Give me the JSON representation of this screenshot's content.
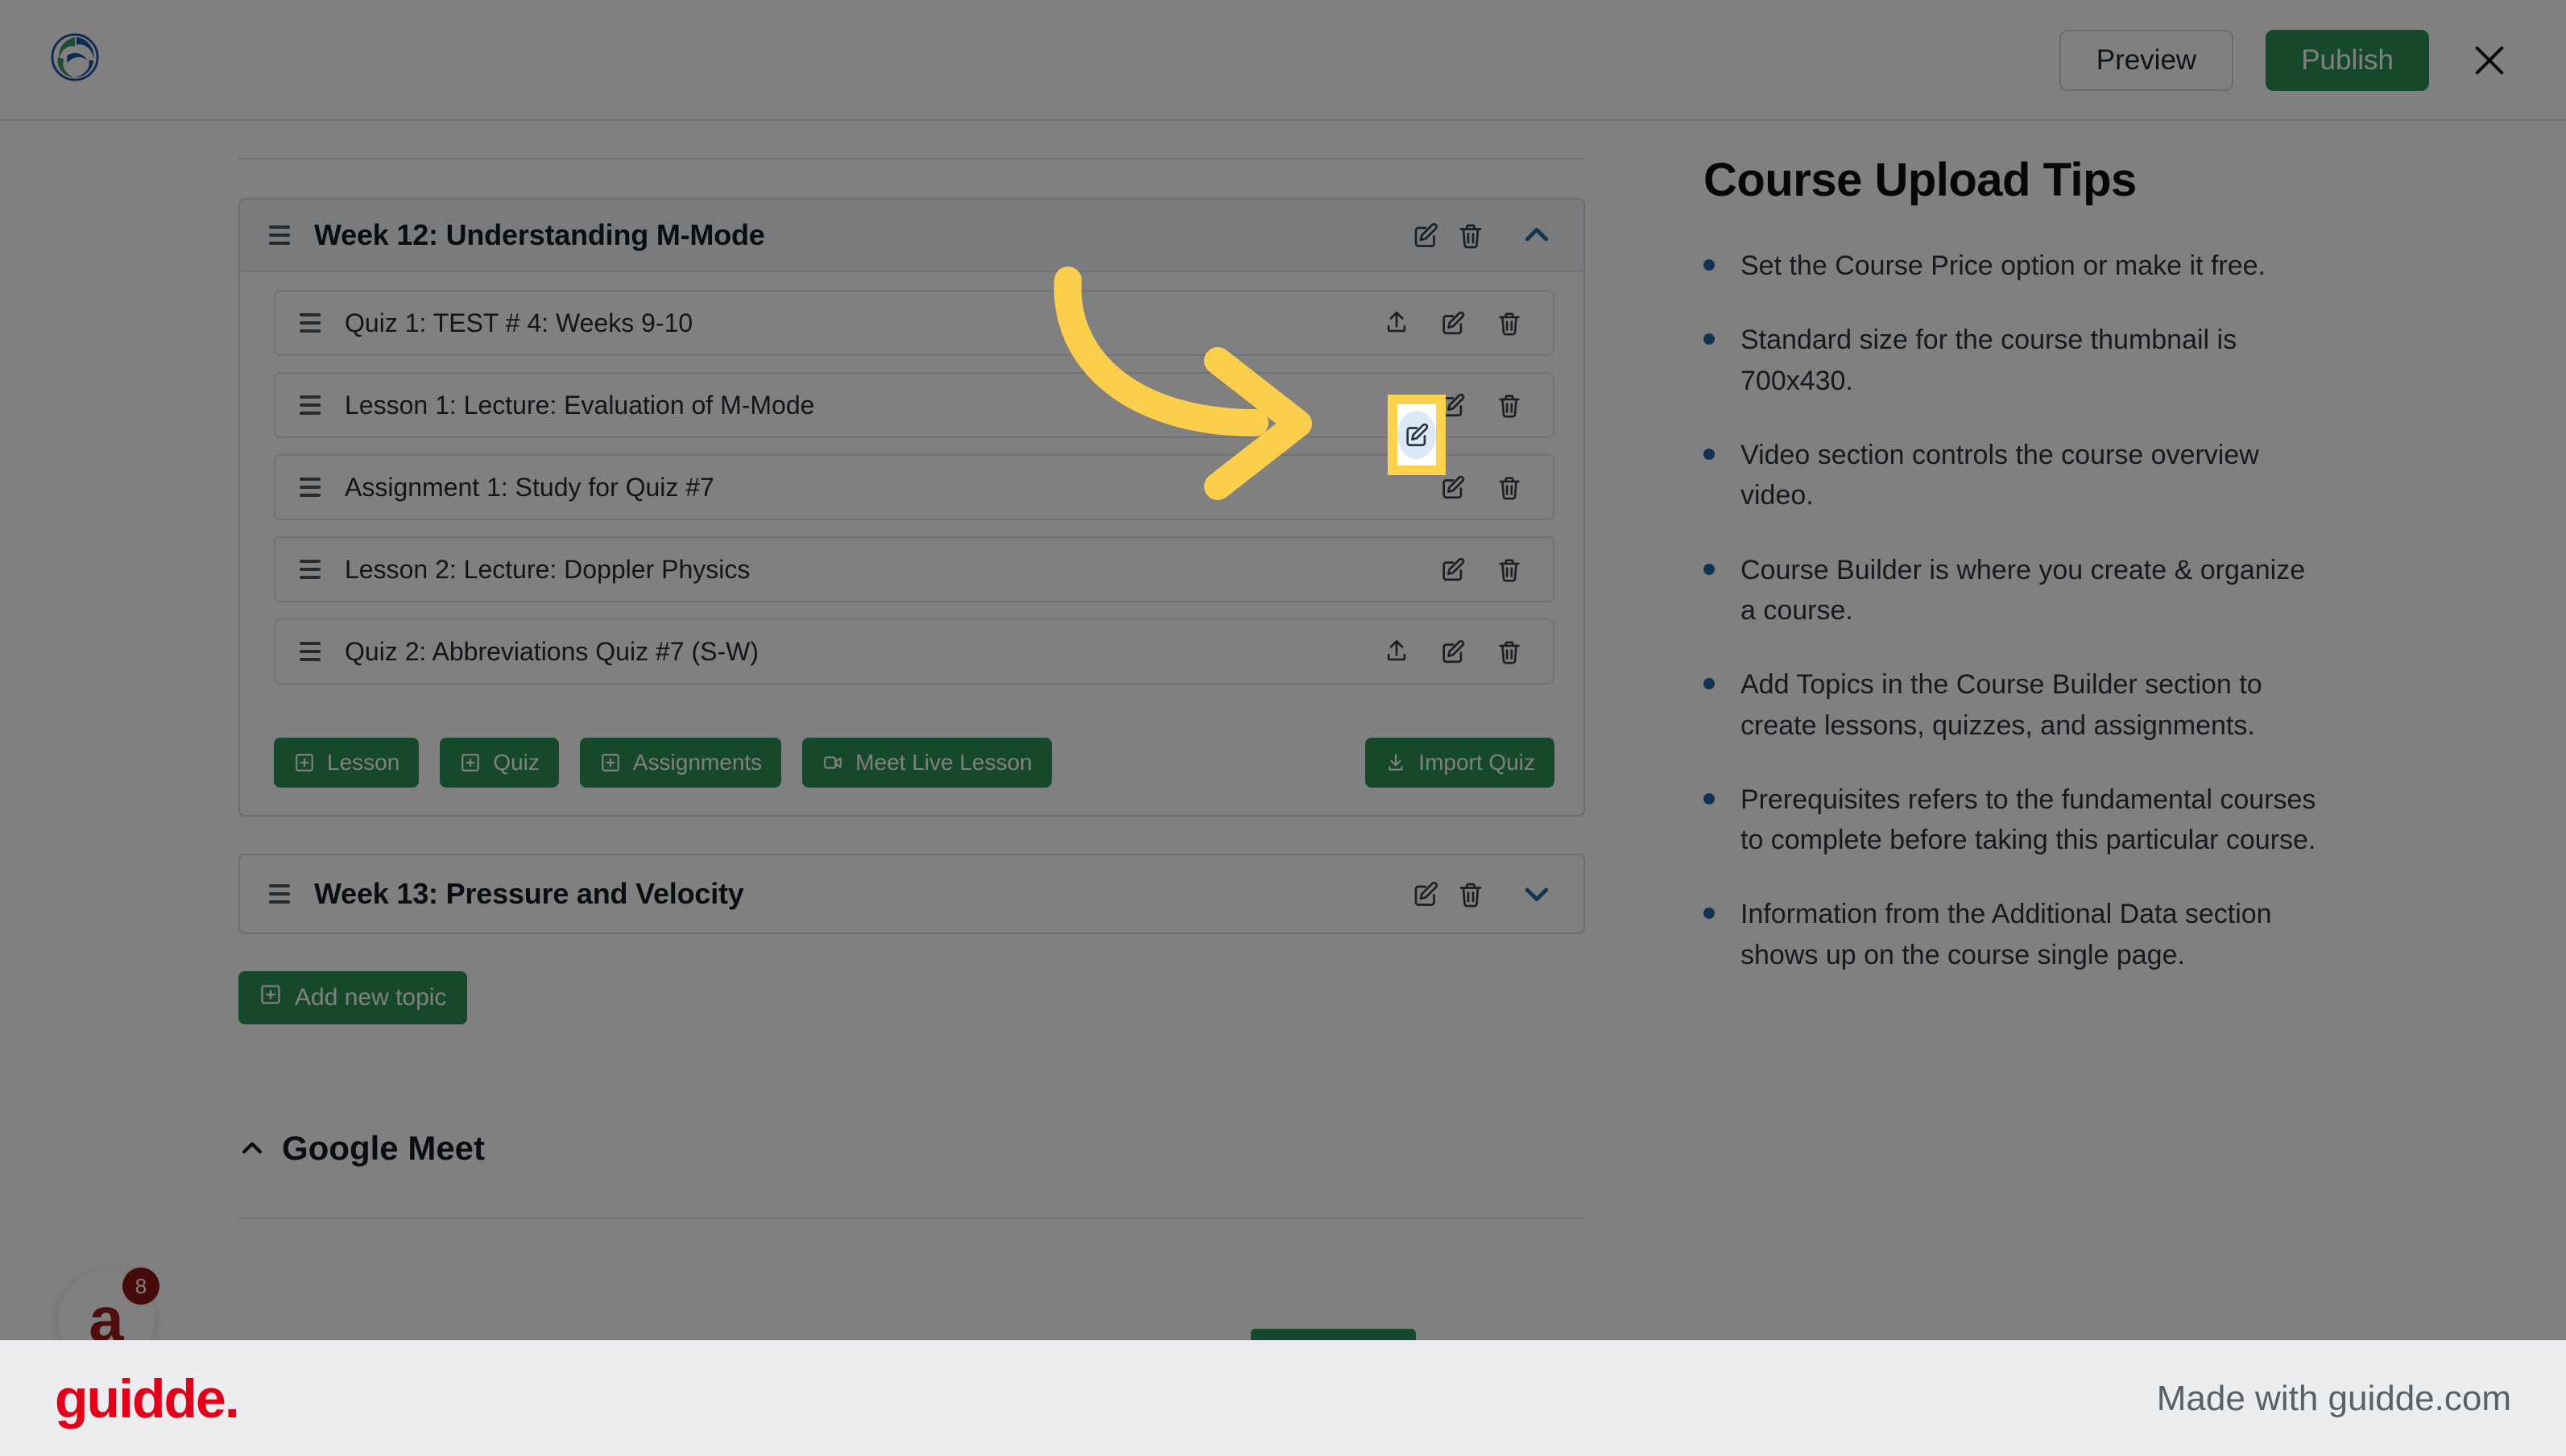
{
  "topbar": {
    "logo_icon": "circular-swirl-logo",
    "preview_label": "Preview",
    "publish_label": "Publish",
    "close_icon": "close-icon"
  },
  "builder": {
    "topics": [
      {
        "title": "Week 12: Understanding M-Mode",
        "expanded": true,
        "collapse_icon": "chevron-up-icon",
        "items": [
          {
            "title": "Quiz 1: TEST # 4: Weeks 9-10",
            "type": "quiz",
            "has_upload": true
          },
          {
            "title": "Lesson 1: Lecture: Evaluation of M-Mode",
            "type": "lesson",
            "has_upload": false,
            "highlighted": true
          },
          {
            "title": "Assignment 1: Study for Quiz #7",
            "type": "assignment",
            "has_upload": false
          },
          {
            "title": "Lesson 2: Lecture: Doppler Physics",
            "type": "lesson",
            "has_upload": false
          },
          {
            "title": "Quiz 2: Abbreviations Quiz #7 (S-W)",
            "type": "quiz",
            "has_upload": true
          }
        ],
        "actions": [
          {
            "label": "Lesson",
            "icon": "plus-square-icon"
          },
          {
            "label": "Quiz",
            "icon": "plus-square-icon"
          },
          {
            "label": "Assignments",
            "icon": "plus-square-icon"
          },
          {
            "label": "Meet Live Lesson",
            "icon": "video-camera-icon"
          }
        ],
        "import_action": {
          "label": "Import Quiz",
          "icon": "download-tray-icon"
        }
      },
      {
        "title": "Week 13: Pressure and Velocity",
        "expanded": false,
        "collapse_icon": "chevron-down-icon"
      }
    ],
    "add_topic": {
      "label": "Add new topic",
      "icon": "plus-square-icon"
    },
    "google_meet": {
      "label": "Google Meet",
      "toggle_icon": "chevron-up-icon"
    },
    "row_icons": {
      "drag": "drag-handle-icon",
      "upload": "upload-icon",
      "edit": "edit-pencil-icon",
      "delete": "trash-icon"
    }
  },
  "tips": {
    "title": "Course Upload Tips",
    "items": [
      "Set the Course Price option or make it free.",
      "Standard size for the course thumbnail is 700x430.",
      "Video section controls the course overview video.",
      "Course Builder is where you create & organize a course.",
      "Add Topics in the Course Builder section to create lessons, quizzes, and assignments.",
      "Prerequisites refers to the fundamental courses to complete before taking this particular course.",
      "Information from the Additional Data section shows up on the course single page."
    ]
  },
  "chat_widget": {
    "mark": "a",
    "badge_count": "8"
  },
  "footer": {
    "logo_text": "guidde.",
    "made_with": "Made with guidde.com"
  },
  "colors": {
    "accent_green": "#2d9157",
    "highlight_yellow": "#fcd34a",
    "bullet_blue": "#2166a8",
    "chevron_blue": "#2b6ca3",
    "guidde_red": "#e3001b"
  }
}
